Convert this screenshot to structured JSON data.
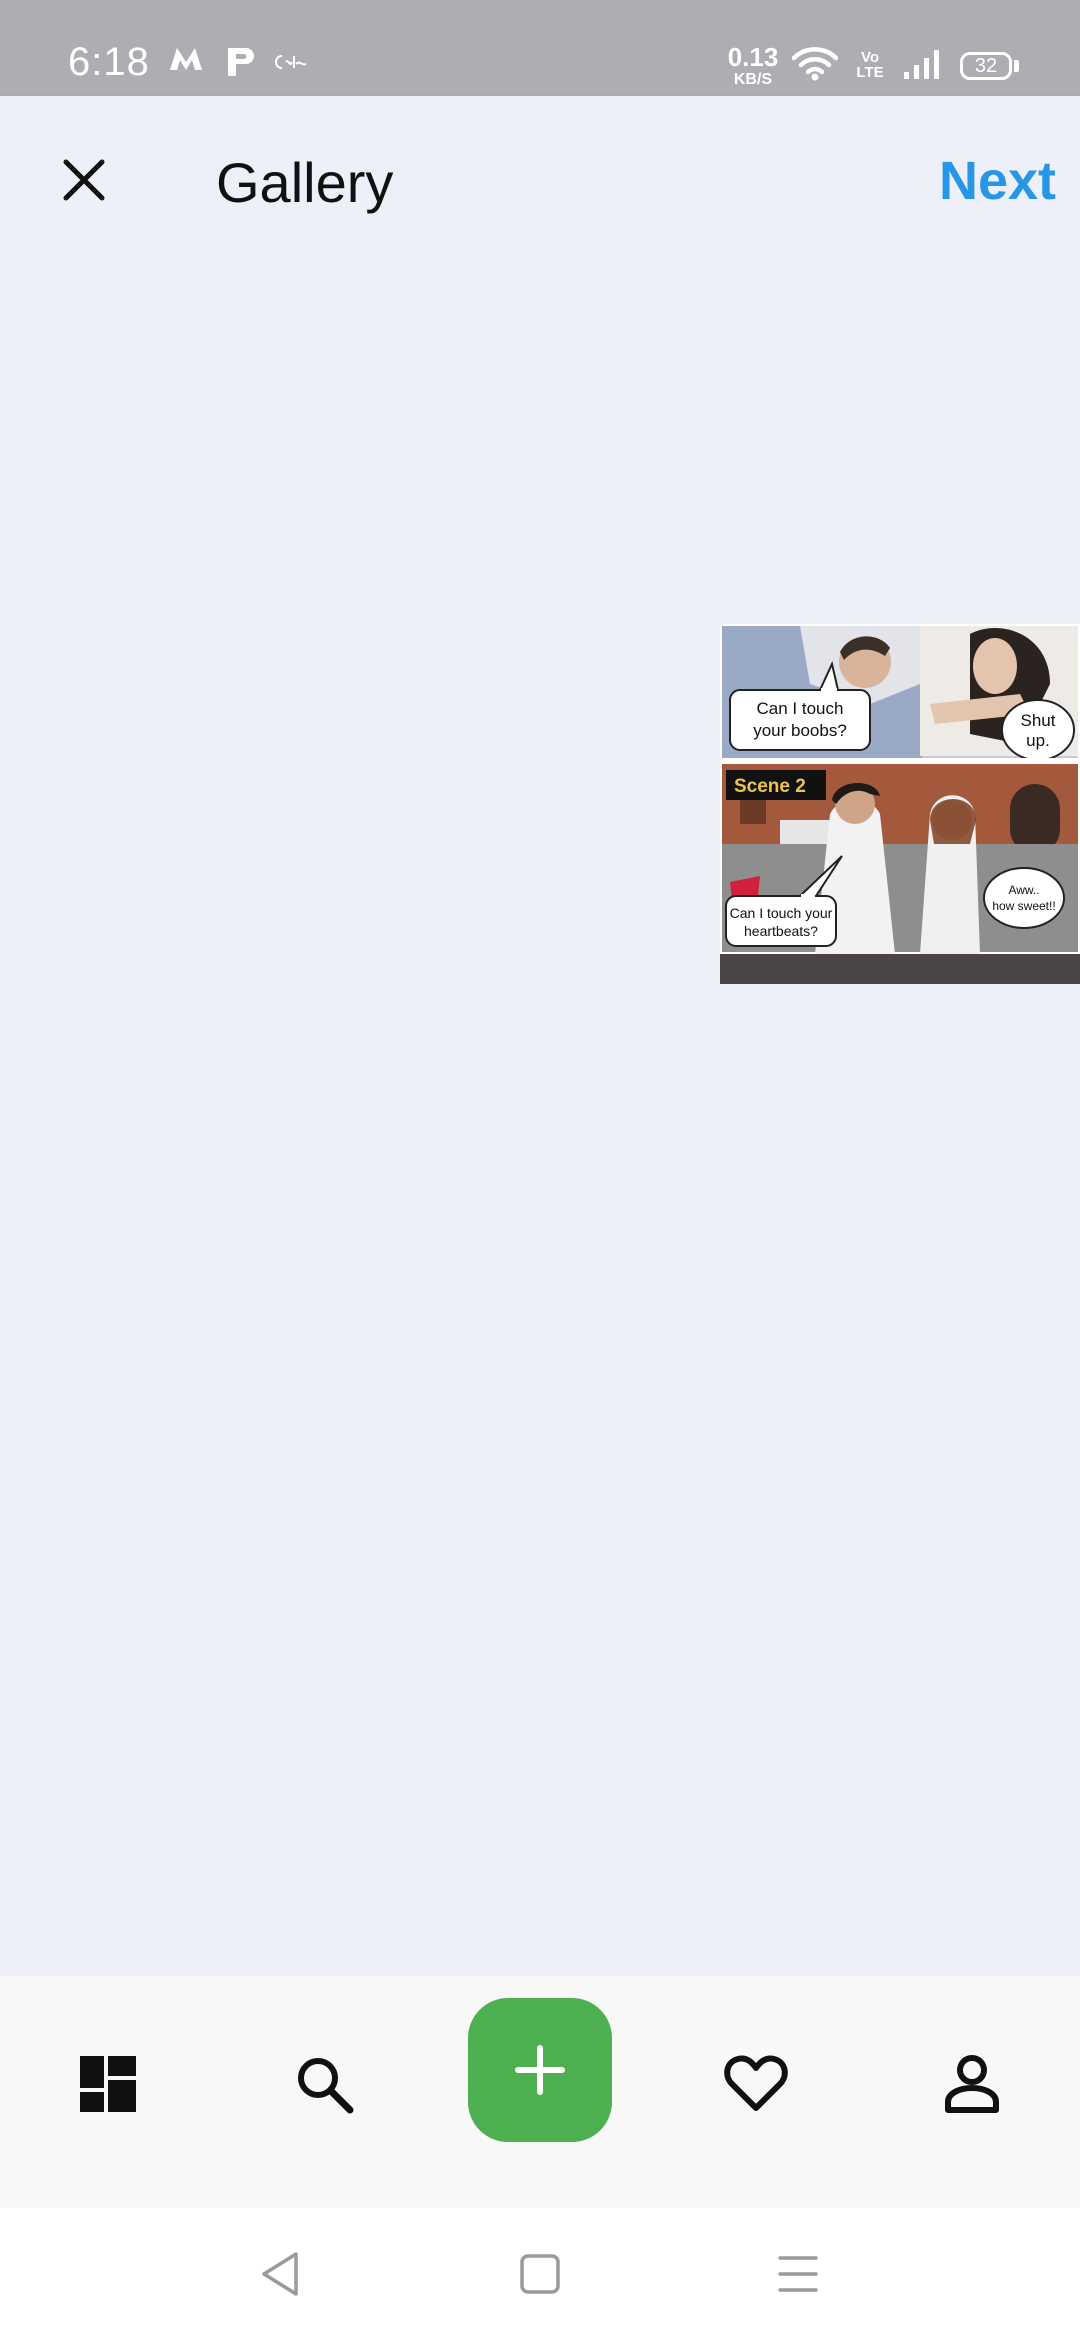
{
  "status_bar": {
    "time": "6:18",
    "app_icons": [
      "myntra-icon",
      "paytm-icon",
      "cakes-icon"
    ],
    "network_speed": "0.13",
    "network_speed_unit": "KB/S",
    "volte_top": "Vo",
    "volte_bottom": "LTE",
    "battery": "32"
  },
  "header": {
    "title": "Gallery",
    "next_label": "Next",
    "accent_color": "#2896e8"
  },
  "gallery": {
    "thumbnail": {
      "scene_label": "Scene 2",
      "bubble_1": "Can I touch your boobs?",
      "bubble_2": "Shut up.",
      "bubble_3": "Can I touch your heartbeats?",
      "bubble_4": "Aww.. how sweet!!"
    }
  },
  "bottom_nav": {
    "items": [
      "dashboard-icon",
      "search-icon",
      "add-icon",
      "heart-icon",
      "profile-icon"
    ],
    "add_color": "#4db050"
  },
  "system_nav": {
    "items": [
      "back-icon",
      "home-icon",
      "menu-icon"
    ]
  }
}
